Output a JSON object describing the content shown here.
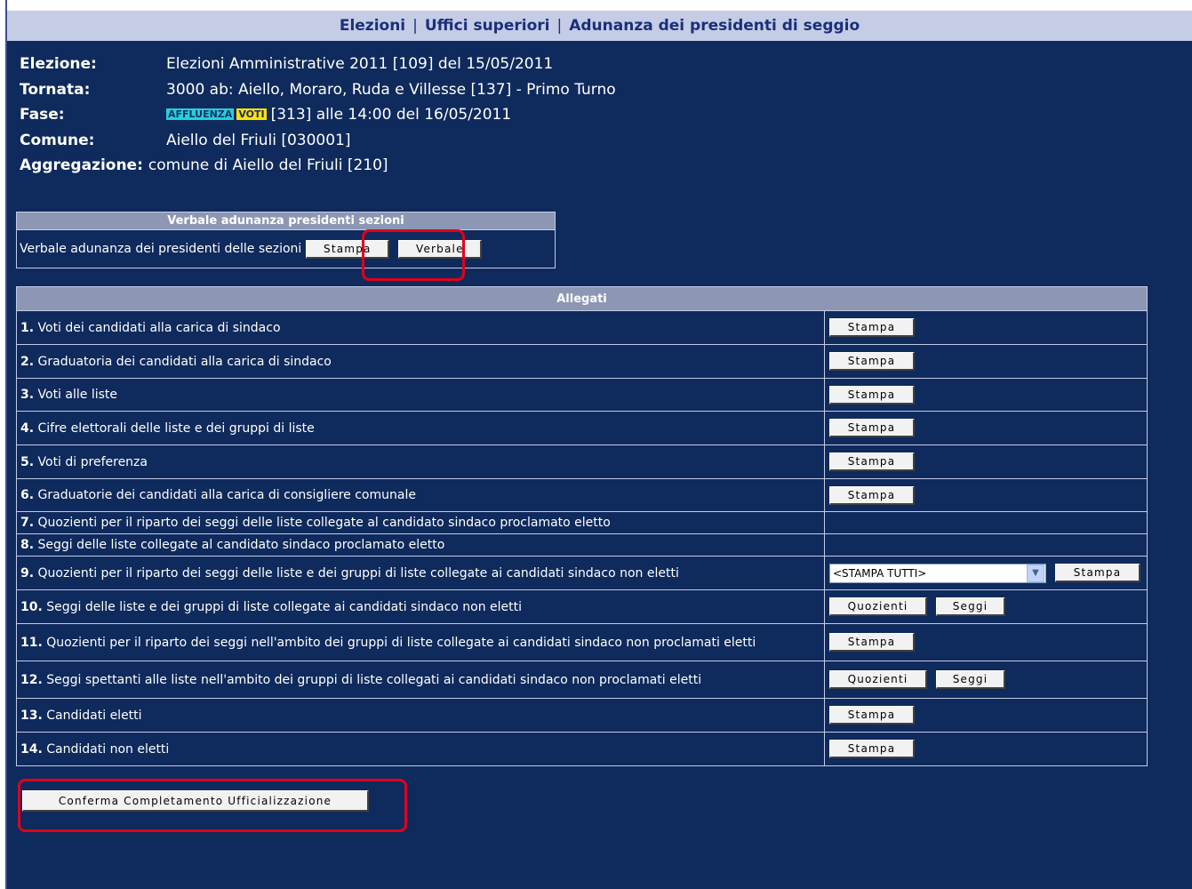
{
  "breadcrumb": {
    "elezioni": "Elezioni",
    "uffici": "Uffici superiori",
    "adunanza": "Adunanza dei presidenti di seggio",
    "sep": "|"
  },
  "info": {
    "elezione_label": "Elezione:",
    "elezione_value": "Elezioni Amministrative 2011 [109] del 15/05/2011",
    "tornata_label": "Tornata:",
    "tornata_value": "3000 ab: Aiello, Moraro, Ruda e Villesse [137] - Primo Turno",
    "fase_label": "Fase:",
    "fase_badge_affluenza": "AFFLUENZA",
    "fase_badge_voti": "VOTI",
    "fase_value": "[313] alle 14:00 del 16/05/2011",
    "comune_label": "Comune:",
    "comune_value": "Aiello del Friuli [030001]",
    "aggregazione_label": "Aggregazione:",
    "aggregazione_value": "comune di Aiello del Friuli [210]"
  },
  "verbale": {
    "header": "Verbale adunanza presidenti sezioni",
    "row_label": "Verbale adunanza dei presidenti delle sezioni",
    "stampa": "Stampa",
    "verbale": "Verbale"
  },
  "allegati": {
    "header": "Allegati",
    "rows": [
      {
        "num": "1.",
        "text": "Voti dei candidati alla carica di sindaco"
      },
      {
        "num": "2.",
        "text": "Graduatoria dei candidati alla carica di sindaco"
      },
      {
        "num": "3.",
        "text": "Voti alle liste"
      },
      {
        "num": "4.",
        "text": "Cifre elettorali delle liste e dei gruppi di liste"
      },
      {
        "num": "5.",
        "text": "Voti di preferenza"
      },
      {
        "num": "6.",
        "text": "Graduatorie dei candidati alla carica di consigliere comunale"
      },
      {
        "num": "7.",
        "text": "Quozienti per il riparto dei seggi delle liste collegate al candidato sindaco proclamato eletto"
      },
      {
        "num": "8.",
        "text": "Seggi delle liste collegate al candidato sindaco proclamato eletto"
      },
      {
        "num": "9.",
        "text": "Quozienti per il riparto dei seggi delle liste e dei gruppi di liste collegate ai candidati sindaco non eletti"
      },
      {
        "num": "10.",
        "text": "Seggi delle liste e dei gruppi di liste collegate ai candidati sindaco non eletti"
      },
      {
        "num": "11.",
        "text": "Quozienti per il riparto dei seggi nell'ambito dei gruppi di liste collegate ai candidati sindaco non proclamati eletti"
      },
      {
        "num": "12.",
        "text": "Seggi spettanti alle liste nell'ambito dei gruppi di liste collegati ai candidati sindaco non proclamati eletti"
      },
      {
        "num": "13.",
        "text": "Candidati eletti"
      },
      {
        "num": "14.",
        "text": "Candidati non eletti"
      }
    ],
    "stampa": "Stampa",
    "quozienti": "Quozienti",
    "seggi": "Seggi",
    "select_value": "<STAMPA TUTTI>"
  },
  "confirm_label": "Conferma Completamento Ufficializzazione",
  "colors": {
    "background": "#0f2a5c",
    "topbar": "#c4cce6",
    "table_header": "#8d97b4",
    "highlight": "#e0001a"
  }
}
